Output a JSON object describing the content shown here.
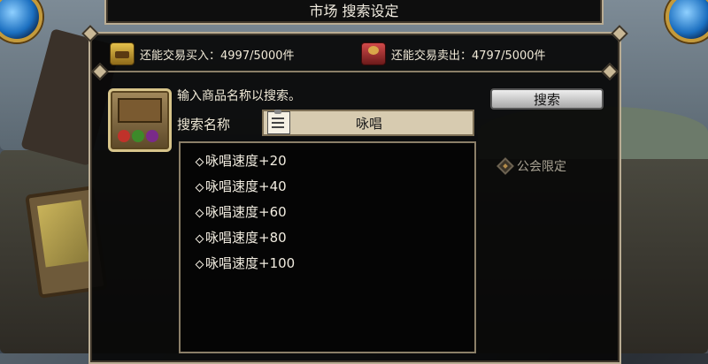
{
  "window": {
    "title": "市场 搜索设定"
  },
  "quota": {
    "buy": "还能交易买入：4997/5000件",
    "sell": "还能交易卖出：4797/5000件"
  },
  "search": {
    "hint": "输入商品名称以搜索。",
    "label": "搜索名称",
    "value": "咏唱",
    "button_label": "搜索"
  },
  "results": [
    {
      "label": "咏唱速度+20"
    },
    {
      "label": "咏唱速度+40"
    },
    {
      "label": "咏唱速度+60"
    },
    {
      "label": "咏唱速度+80"
    },
    {
      "label": "咏唱速度+100"
    }
  ],
  "filters": {
    "guild_label": "公会限定"
  },
  "colors": {
    "panel_border": "#b9ac93",
    "panel_bg": "#080808",
    "text": "#efe8d6",
    "input_bg": "#d7cbb0"
  }
}
